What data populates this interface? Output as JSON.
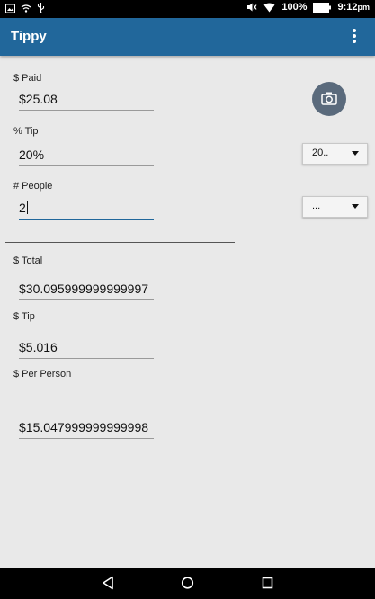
{
  "status": {
    "battery_text": "100%",
    "time": "9:12",
    "time_suffix": "pm"
  },
  "app": {
    "title": "Tippy"
  },
  "paid": {
    "label": "$ Paid",
    "value": "$25.08"
  },
  "tip_percent": {
    "label": "% Tip",
    "value": "20%",
    "spinner_value": "20.."
  },
  "people": {
    "label": "# People",
    "value": "2",
    "spinner_value": "..."
  },
  "total": {
    "label": "$ Total",
    "value": "$30.095999999999997"
  },
  "tip_amount": {
    "label": "$ Tip",
    "value": "$5.016"
  },
  "per_person": {
    "label": "$ Per Person",
    "value": "$15.047999999999998"
  },
  "colors": {
    "accent": "#21679b",
    "camera_button": "#5a6a7c",
    "background": "#e9e9e9"
  },
  "icons": {
    "status_left": [
      "image-icon",
      "wifi-icon",
      "usb-icon"
    ],
    "status_right": [
      "mute-icon",
      "wifi-signal-icon",
      "battery-icon"
    ],
    "camera": "camera-icon",
    "nav": [
      "back-icon",
      "home-icon",
      "recents-icon"
    ]
  }
}
